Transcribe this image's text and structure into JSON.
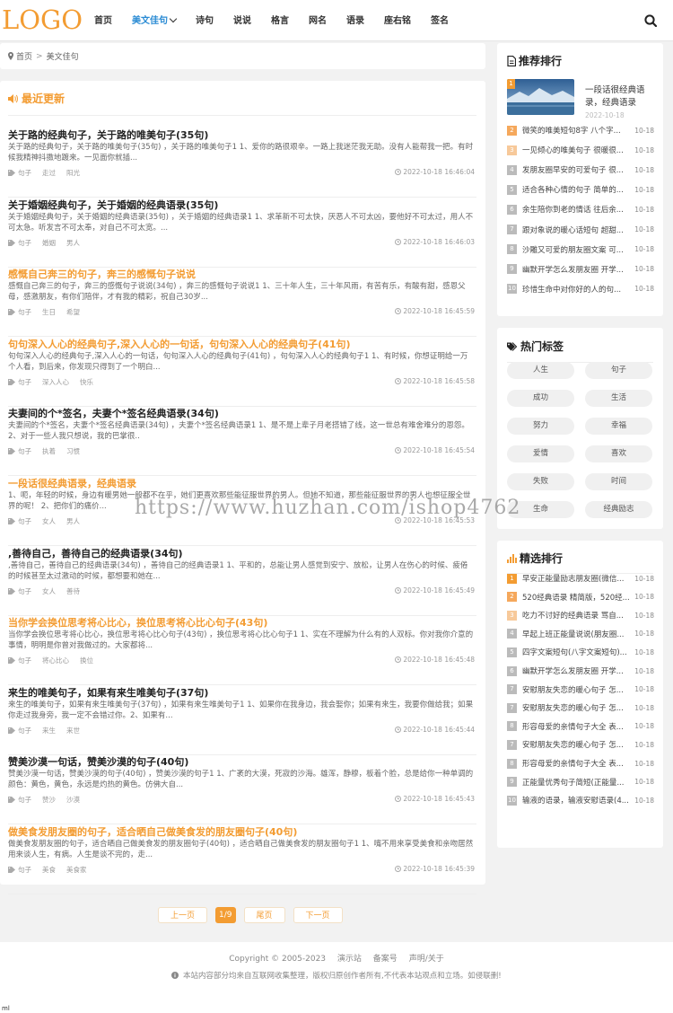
{
  "header": {
    "logo": "LOGO",
    "nav": [
      "首页",
      "美文佳句",
      "诗句",
      "说说",
      "格言",
      "网名",
      "语录",
      "座右铭",
      "签名"
    ],
    "active_index": 1
  },
  "breadcrumb": {
    "home": "首页",
    "sep": ">",
    "current": "美文佳句"
  },
  "main": {
    "section_title": "最近更新",
    "articles": [
      {
        "title": "关于路的经典句子，关于路的唯美句子(35句)",
        "desc": "关于路的经典句子，关于路的唯美句子(35句) ，关于路的唯美句子1 1、爱你的路很艰辛。一路上我迷茫我无助。没有人能帮我一把。有时候我精神抖擞地踱来。一见面你就插...",
        "tags": [
          "句子",
          "走过",
          "阳光"
        ],
        "date": "2022-10-18 16:46:04",
        "highlight": false
      },
      {
        "title": "关于婚姻经典句子，关于婚姻的经典语录(35句)",
        "desc": "关于婚姻经典句子，关于婚姻的经典语录(35句) ，关于婚姻的经典语录1 1、求革新不可太快，厌恶人不可太凶，要他好不可太过，用人不可太急。听发言不可太奉，对自己不可太宽。...",
        "tags": [
          "句子",
          "婚姻",
          "男人"
        ],
        "date": "2022-10-18 16:46:03",
        "highlight": false
      },
      {
        "title": "感慨自己奔三的句子，奔三的感慨句子说说",
        "desc": "感慨自己奔三的句子，奔三的感慨句子说说(34句) ，奔三的感慨句子说说1 1、三十年人生，三十年风雨，有苦有乐，有酸有甜，感恩父母，感激朋友，有你们陪伴，才有我的精彩，祝自己30岁...",
        "tags": [
          "句子",
          "生日",
          "希望"
        ],
        "date": "2022-10-18 16:45:59",
        "highlight": true
      },
      {
        "title": "句句深入人心的经典句子,深入人心的一句话，句句深入人心的经典句子(41句)",
        "desc": "句句深入人心的经典句子,深入人心的一句话，句句深入人心的经典句子(41句) ，句句深入人心的经典句子1 1、有时候，你想证明给一万个人看，到后来，你发现只得到了一个明白...",
        "tags": [
          "句子",
          "深入人心",
          "快乐"
        ],
        "date": "2022-10-18 16:45:58",
        "highlight": true
      },
      {
        "title": "夫妻间的个*签名，夫妻个*签名经典语录(34句)",
        "desc": "夫妻间的个*签名，夫妻个*签名经典语录(34句) ，夫妻个*签名经典语录1 1、是不是上辈子月老搭错了线，这一世总有难舍难分的恩怨。2、对于一些人我只想说，我的巴掌很..",
        "tags": [
          "句子",
          "执着",
          "习惯"
        ],
        "date": "2022-10-18 16:45:54",
        "highlight": false
      },
      {
        "title": "一段话很经典语录，经典语录",
        "desc": "1、呃，年轻的时候，身边有暖男她一般都不在乎，她们更喜欢那些能征服世界的男人。但她不知道，那些能征服世界的男人也想征服全世界的呢！ 2、把你们的痛价...",
        "tags": [
          "句子",
          "女人",
          "男人"
        ],
        "date": "2022-10-18 16:45:53",
        "highlight": true
      },
      {
        "title": ",善待自己，善待自己的经典语录(34句)",
        "desc": ",善待自己，善待自己的经典语录(34句) ，善待自己的经典语录1 1、平和的，总能让男人感觉到安宁、放松，让男人在伤心的时候、疲倦的时候甚至太过激动的时候，都想要和她在...",
        "tags": [
          "句子",
          "女人",
          "善待"
        ],
        "date": "2022-10-18 16:45:49",
        "highlight": false
      },
      {
        "title": "当你学会换位思考将心比心，换位思考将心比心句子(43句)",
        "desc": "当你学会换位思考将心比心，换位思考将心比心句子(43句) ，换位思考将心比心句子1 1、实在不理解为什么有的人双标。你对我你介意的事情，明明是你曾对我做过的。大家都将...",
        "tags": [
          "句子",
          "将心比心",
          "换位"
        ],
        "date": "2022-10-18 16:45:48",
        "highlight": true
      },
      {
        "title": "来生的唯美句子，如果有来生唯美句子(37句)",
        "desc": "来生的唯美句子，如果有来生唯美句子(37句) ，如果有来生唯美句子1 1、如果你在我身边，我会娶你；如果有来生，我要你做给我；如果你走过我身旁，我一定不会错过你。2、如果有...",
        "tags": [
          "句子",
          "来生",
          "来世"
        ],
        "date": "2022-10-18 16:45:44",
        "highlight": false
      },
      {
        "title": "赞美沙漠一句话，赞美沙漠的句子(40句)",
        "desc": "赞美沙漠一句话，赞美沙漠的句子(40句) ，赞美沙漠的句子1 1、广袤的大漠，死寂的沙海。雄浑，静穆，板着个脸，总是给你一种单调的颜色：黄色，黄色，永远是灼热的黄色。仿佛大自...",
        "tags": [
          "句子",
          "赞沙",
          "沙漠"
        ],
        "date": "2022-10-18 16:45:43",
        "highlight": false
      },
      {
        "title": "做美食发朋友圈的句子，适合晒自己做美食发的朋友圈句子(40句)",
        "desc": "做美食发朋友圈的句子，适合晒自己做美食发的朋友圈句子(40句) ，适合晒自己做美食发的朋友圈句子1 1、嘴不用来享受美食和亲吻居然用来谈人生，有病。人生是谈不完的，走...",
        "tags": [
          "句子",
          "美食",
          "美食家"
        ],
        "date": "2022-10-18 16:45:39",
        "highlight": true
      }
    ]
  },
  "pagination": {
    "prev": "上一页",
    "current": "1/9",
    "last": "尾页",
    "next": "下一页"
  },
  "sidebar": {
    "recommend": {
      "title": "推荐排行",
      "featured": {
        "num": "1",
        "title": "一段话很经典语录，经典语录",
        "date": "2022-10-18"
      },
      "items": [
        {
          "num": "2",
          "title": "微笑的唯美短句8字 八个字...",
          "date": "10-18"
        },
        {
          "num": "3",
          "title": "一见倾心的唯美句子 很暖很...",
          "date": "10-18"
        },
        {
          "num": "4",
          "title": "发朋友圈早安的可爱句子 很...",
          "date": "10-18"
        },
        {
          "num": "5",
          "title": "适合各种心情的句子 简单的...",
          "date": "10-18"
        },
        {
          "num": "6",
          "title": "余生陪你到老的情话 往后余...",
          "date": "10-18"
        },
        {
          "num": "7",
          "title": "跟对象说的暖心话短句 超甜...",
          "date": "10-18"
        },
        {
          "num": "8",
          "title": "沙雕又可爱的朋友圈文案 可...",
          "date": "10-18"
        },
        {
          "num": "9",
          "title": "幽默开学怎么发朋友圈 开学...",
          "date": "10-18"
        },
        {
          "num": "10",
          "title": "珍惜生命中对你好的人的句...",
          "date": "10-18"
        }
      ]
    },
    "tags": {
      "title": "热门标签",
      "items": [
        "人生",
        "句子",
        "成功",
        "生活",
        "努力",
        "幸福",
        "爱情",
        "喜欢",
        "失败",
        "时间",
        "生命",
        "经典励志"
      ]
    },
    "picks": {
      "title": "精选排行",
      "items": [
        {
          "num": "1",
          "title": "早安正能量励志朋友圈(微信...",
          "date": "10-18"
        },
        {
          "num": "2",
          "title": "520经典语录 精简版，520经...",
          "date": "10-18"
        },
        {
          "num": "3",
          "title": "吃力不讨好的经典语录 骂自...",
          "date": "10-18"
        },
        {
          "num": "4",
          "title": "早起上班正能量说说(朋友圈...",
          "date": "10-18"
        },
        {
          "num": "5",
          "title": "四字文案短句(八字文案短句)...",
          "date": "10-18"
        },
        {
          "num": "6",
          "title": "幽默开学怎么发朋友圈 开学...",
          "date": "10-18"
        },
        {
          "num": "7",
          "title": "安慰朋友失恋的暖心句子 怎...",
          "date": "10-18"
        },
        {
          "num": "7",
          "title": "安慰朋友失恋的暖心句子 怎...",
          "date": "10-18"
        },
        {
          "num": "8",
          "title": "形容母爱的亲情句子大全 表...",
          "date": "10-18"
        },
        {
          "num": "7",
          "title": "安慰朋友失恋的暖心句子 怎...",
          "date": "10-18"
        },
        {
          "num": "8",
          "title": "形容母爱的亲情句子大全 表...",
          "date": "10-18"
        },
        {
          "num": "9",
          "title": "正能量优秀句子简短(正能量...",
          "date": "10-18"
        },
        {
          "num": "10",
          "title": "输液的语录，输液安慰语录(4...",
          "date": "10-18"
        }
      ]
    }
  },
  "footer": {
    "copyright": "Copyright © 2005-2023",
    "links": [
      "演示站",
      "备案号",
      "声明/关于"
    ],
    "notice": "本站内容部分均来自互联网收集整理，版权归原创作者所有,不代表本站观点和立场。如侵联删!",
    "corner": "ml"
  },
  "watermark": "https://www.huzhan.com/ishop4762",
  "colors": {
    "accent": "#f39c32",
    "nav_active": "#2a8bd4"
  }
}
